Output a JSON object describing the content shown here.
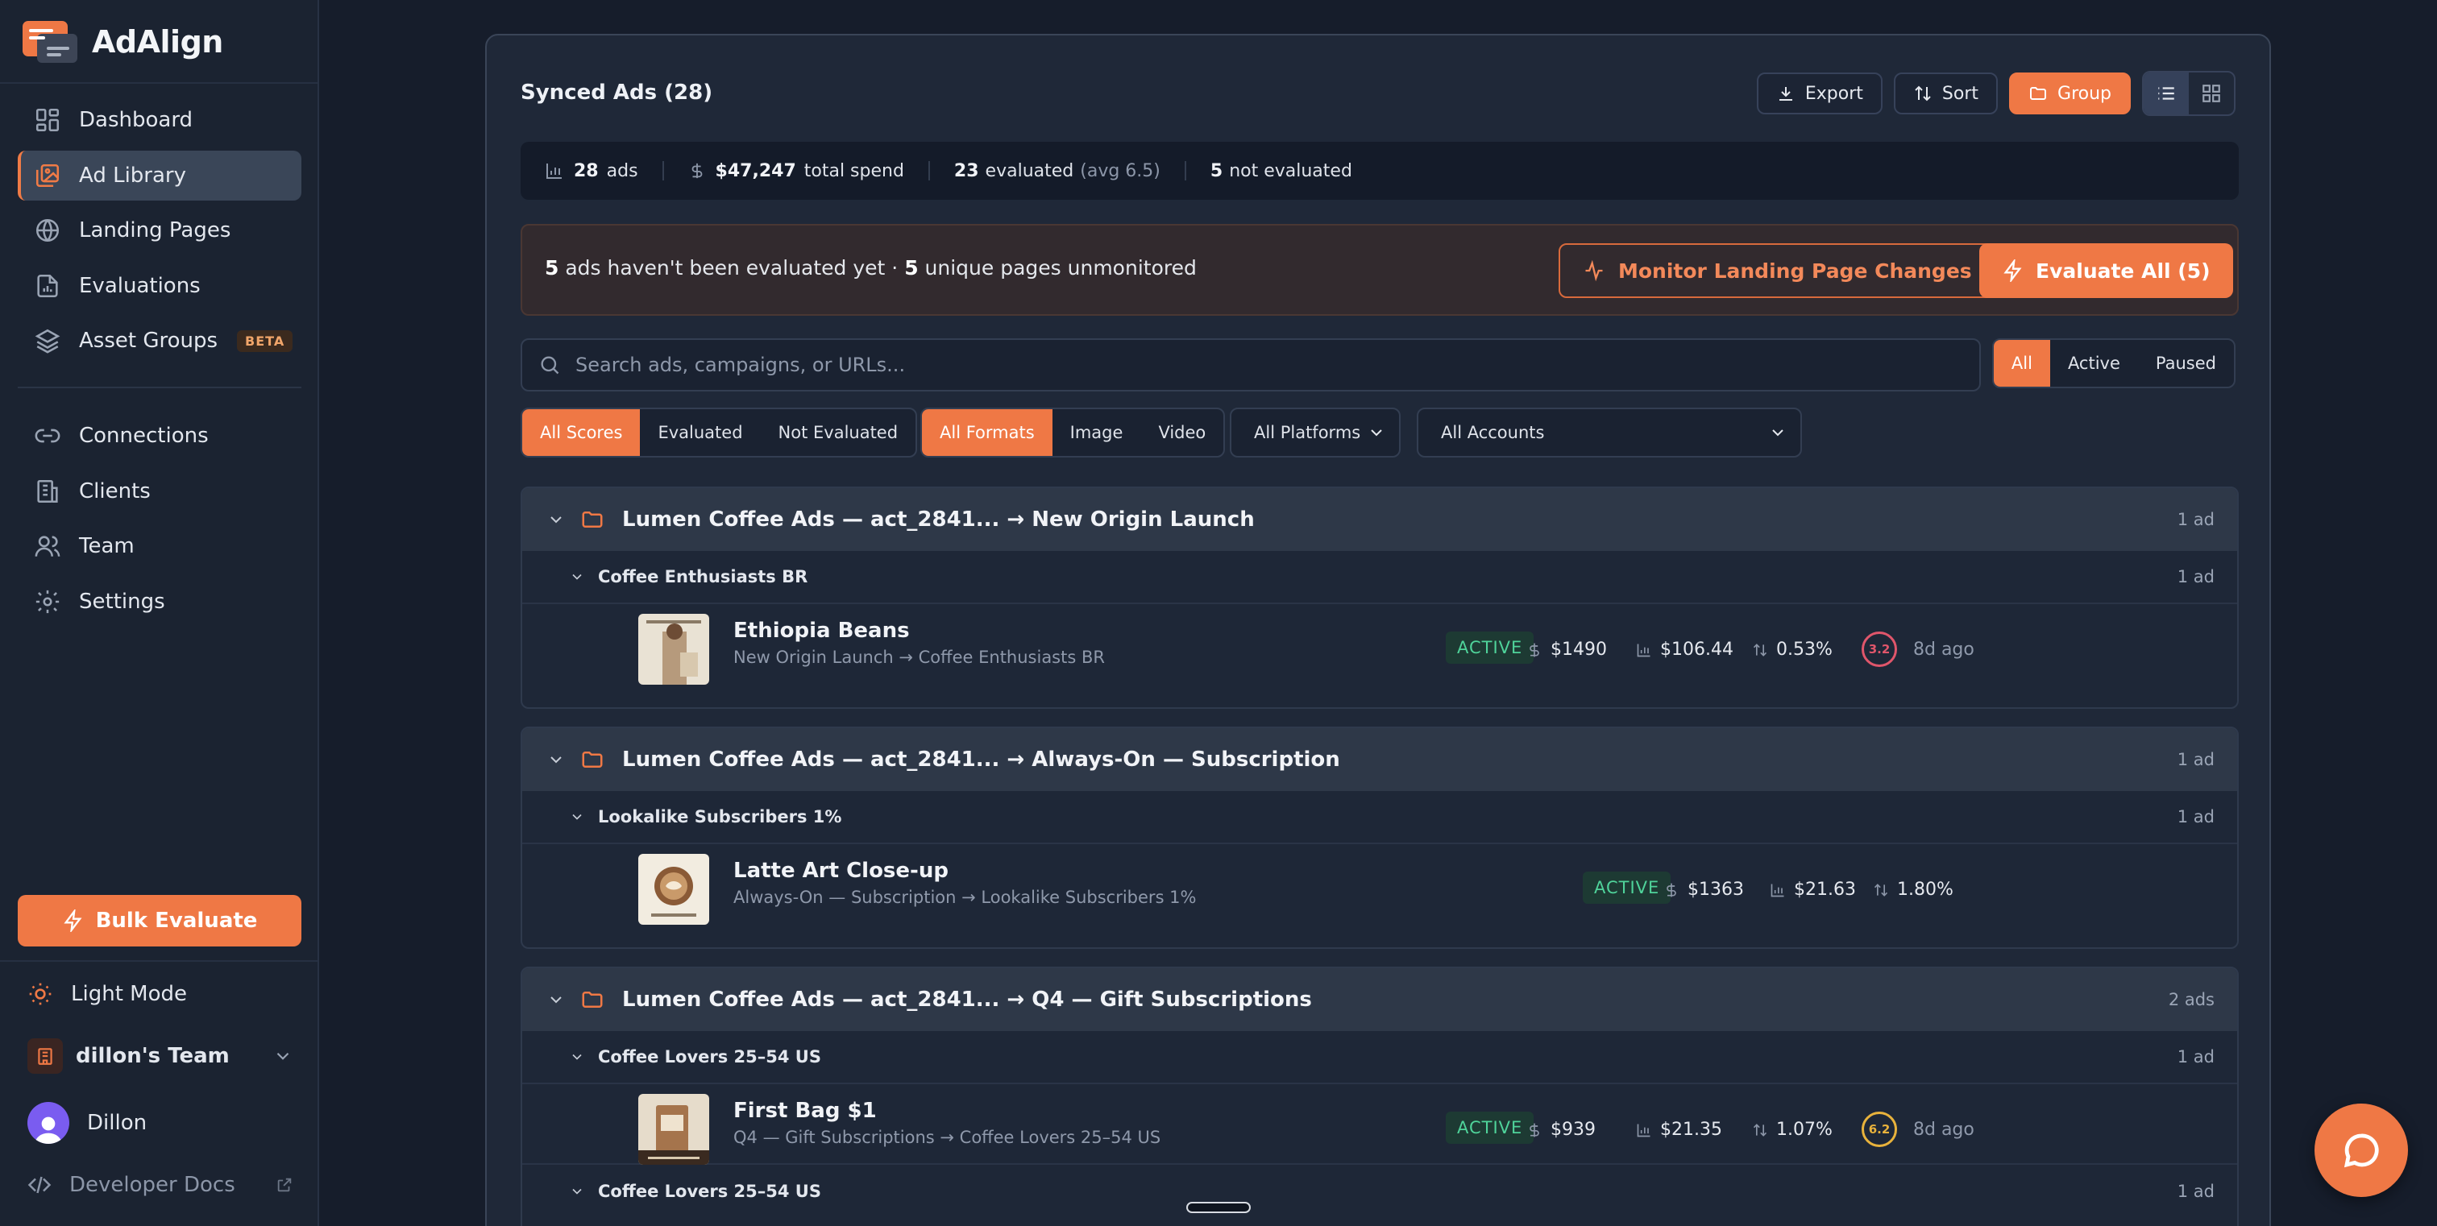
{
  "app": {
    "name": "AdAlign"
  },
  "sidebar": {
    "nav": [
      {
        "label": "Dashboard",
        "icon": "grid-icon"
      },
      {
        "label": "Ad Library",
        "icon": "image-stack-icon",
        "active": true
      },
      {
        "label": "Landing Pages",
        "icon": "globe-icon"
      },
      {
        "label": "Evaluations",
        "icon": "report-icon"
      },
      {
        "label": "Asset Groups",
        "icon": "layers-icon",
        "badge": "BETA"
      }
    ],
    "nav2": [
      {
        "label": "Connections",
        "icon": "link-icon"
      },
      {
        "label": "Clients",
        "icon": "building-icon"
      },
      {
        "label": "Team",
        "icon": "users-icon"
      },
      {
        "label": "Settings",
        "icon": "gear-icon"
      }
    ],
    "bulk_evaluate": "Bulk Evaluate",
    "light_mode": "Light Mode",
    "team_name": "dillon's Team",
    "user_name": "Dillon",
    "developer_docs": "Developer Docs"
  },
  "main": {
    "title": "Synced Ads (28)",
    "toolbar": {
      "export": "Export",
      "sort": "Sort",
      "group": "Group"
    },
    "stats": {
      "ads_count": "28",
      "ads_label": "ads",
      "spend": "$47,247",
      "spend_label": "total spend",
      "evaluated": "23",
      "evaluated_label": "evaluated",
      "evaluated_avg": "(avg 6.5)",
      "not_evaluated": "5",
      "not_evaluated_label": "not evaluated"
    },
    "alert": {
      "count": "5",
      "text1": "ads haven't been evaluated yet ·",
      "pages": "5",
      "text2": "unique pages unmonitored",
      "monitor_btn": "Monitor Landing Page Changes (5)",
      "evaluate_btn": "Evaluate All (5)"
    },
    "search_placeholder": "Search ads, campaigns, or URLs...",
    "status_filter": [
      "All",
      "Active",
      "Paused"
    ],
    "score_filter": [
      "All Scores",
      "Evaluated",
      "Not Evaluated"
    ],
    "format_filter": [
      "All Formats",
      "Image",
      "Video"
    ],
    "platforms": "All Platforms",
    "accounts": "All Accounts",
    "groups": [
      {
        "title": "Lumen Coffee Ads — act_2841... → New Origin Launch",
        "count": "1 ad",
        "subgroup": "Coffee Enthusiasts BR",
        "sub_count": "1 ad",
        "ad": {
          "name": "Ethiopia Beans",
          "path": "New Origin Launch → Coffee Enthusiasts BR",
          "status": "ACTIVE",
          "spend": "$1490",
          "cpa": "$106.44",
          "ctr": "0.53%",
          "score": "3.2",
          "ago": "8d ago"
        }
      },
      {
        "title": "Lumen Coffee Ads — act_2841... → Always-On — Subscription",
        "count": "1 ad",
        "subgroup": "Lookalike Subscribers 1%",
        "sub_count": "1 ad",
        "ad": {
          "name": "Latte Art Close-up",
          "path": "Always-On — Subscription → Lookalike Subscribers 1%",
          "status": "ACTIVE",
          "spend": "$1363",
          "cpa": "$21.63",
          "ctr": "1.80%"
        }
      },
      {
        "title": "Lumen Coffee Ads — act_2841... → Q4 — Gift Subscriptions",
        "count": "2 ads",
        "subgroup": "Coffee Lovers 25–54 US",
        "sub_count": "1 ad",
        "ad": {
          "name": "First Bag $1",
          "path": "Q4 — Gift Subscriptions → Coffee Lovers 25–54 US",
          "status": "ACTIVE",
          "spend": "$939",
          "cpa": "$21.35",
          "ctr": "1.07%",
          "score": "6.2",
          "ago": "8d ago"
        },
        "subgroup2": "Coffee Lovers 25–54 US",
        "sub_count2": "1 ad"
      }
    ]
  },
  "colors": {
    "accent": "#ef7845",
    "active_green": "#4fd39a",
    "score_low": "#e0566b",
    "score_mid": "#e8b23c"
  }
}
